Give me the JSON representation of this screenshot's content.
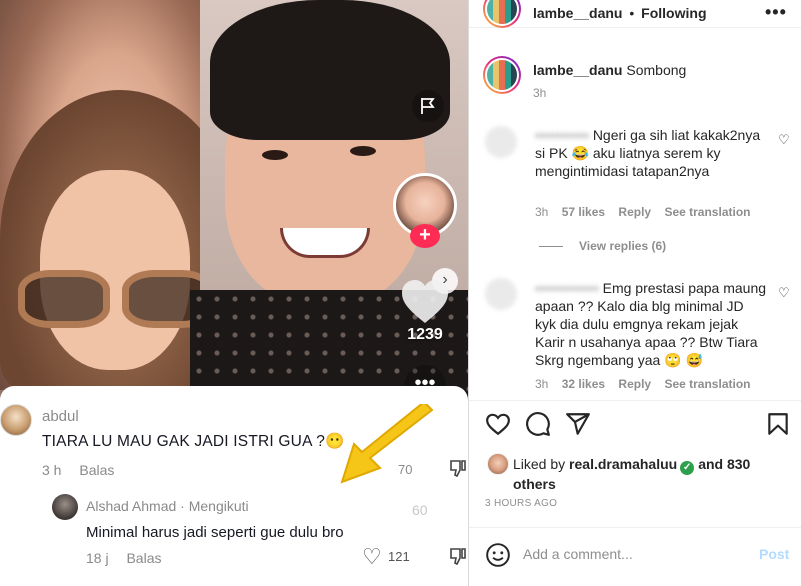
{
  "video": {
    "like_count": "1239",
    "more_icon": "dots-icon",
    "comments": [
      {
        "user": "abdul",
        "text": "TIARA LU MAU GAK JADI ISTRI GUA ?😶",
        "time": "3 h",
        "reply": "Balas",
        "side_count": "70"
      },
      {
        "user": "Alshad Ahmad · Mengikuti",
        "text": "Minimal harus jadi seperti gue dulu bro",
        "time": "18 j",
        "reply": "Balas",
        "likes": "121",
        "faded_count": "60"
      }
    ]
  },
  "ig": {
    "header": {
      "username": "lambe__danu",
      "separator": "•",
      "follow_status": "Following",
      "more": "•••"
    },
    "caption": {
      "username": "lambe__danu",
      "text": "Sombong",
      "time": "3h"
    },
    "comments": [
      {
        "user": "•••••••••••",
        "text": "Ngeri ga sih liat kakak2nya si PK 😂 aku liatnya serem ky mengintimidasi tatapan2nya",
        "time": "3h",
        "likes": "57 likes",
        "reply": "Reply",
        "translate": "See translation",
        "view_replies": "View replies (6)"
      },
      {
        "user": "•••••••••••••",
        "text": "Emg prestasi papa maung apaan ?? Kalo dia blg minimal JD kyk dia dulu emgnya rekam jejak Karir n usahanya apaa ?? Btw Tiara Skrg ngembang yaa 🙄 😅",
        "time": "3h",
        "likes": "32 likes",
        "reply": "Reply",
        "translate": "See translation"
      }
    ],
    "liked_by": {
      "prefix": "Liked by",
      "user": "real.dramahaluu",
      "suffix": "and 830 others"
    },
    "post_time": "3 HOURS AGO",
    "add_comment": {
      "placeholder": "Add a comment...",
      "post_label": "Post"
    }
  }
}
